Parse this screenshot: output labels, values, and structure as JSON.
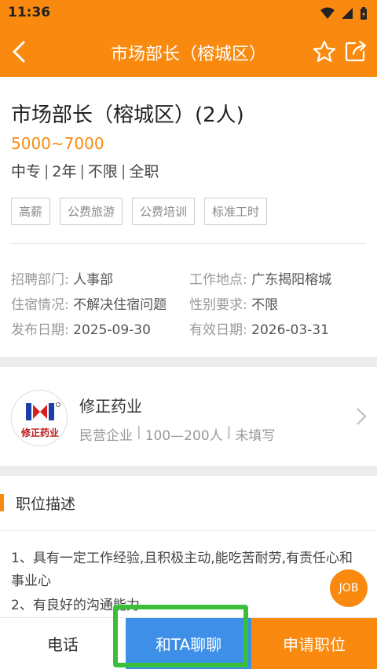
{
  "status": {
    "time": "11:36"
  },
  "header": {
    "title": "市场部长（榕城区）"
  },
  "job": {
    "title": "市场部长（榕城区）(2人)",
    "salary": "5000~7000",
    "requirements": [
      "中专",
      "2年",
      "不限",
      "全职"
    ],
    "tags": [
      "高薪",
      "公费旅游",
      "公费培训",
      "标准工时"
    ]
  },
  "details": {
    "dept_label": "招聘部门:",
    "dept_value": "人事部",
    "location_label": "工作地点:",
    "location_value": "广东揭阳榕城",
    "housing_label": "住宿情况:",
    "housing_value": "不解决住宿问题",
    "gender_label": "性别要求:",
    "gender_value": "不限",
    "publish_label": "发布日期:",
    "publish_value": "2025-09-30",
    "valid_label": "有效日期:",
    "valid_value": "2026-03-31"
  },
  "company": {
    "name": "修正药业",
    "logo_text": "修正药业",
    "type": "民营企业",
    "size": "100—200人",
    "extra": "未填写"
  },
  "section": {
    "title": "职位描述"
  },
  "description": {
    "line1": "1、具有一定工作经验,且积极主动,能吃苦耐劳,有责任心和事业心",
    "line2": "2、有良好的沟通能力"
  },
  "fab": {
    "label": "JOB"
  },
  "bottom": {
    "phone": "电话",
    "chat": "和TA聊聊",
    "apply": "申请职位"
  },
  "colors": {
    "accent": "#f98a0f",
    "chat": "#3d8fe8",
    "highlight": "#3bbf3b"
  }
}
